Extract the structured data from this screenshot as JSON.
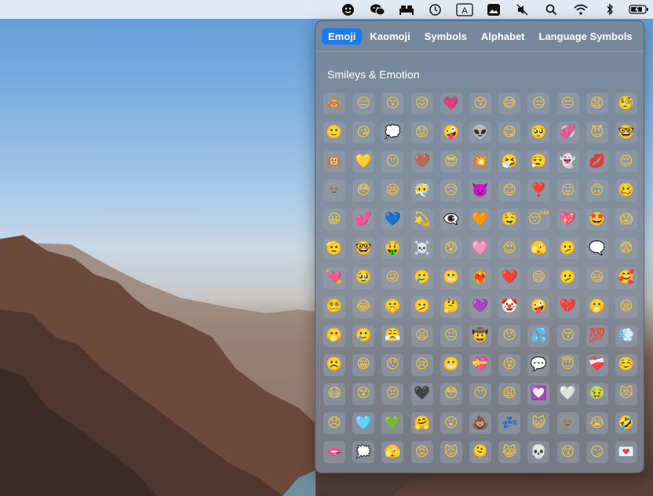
{
  "menubar": {
    "icons": [
      "smiley-icon",
      "wechat-icon",
      "bed-icon",
      "history-icon",
      "input-source-icon",
      "photo-icon",
      "mute-icon",
      "search-icon",
      "wifi-icon",
      "bluetooth-icon",
      "battery-icon"
    ],
    "input_source_label": "A"
  },
  "panel": {
    "tabs": [
      {
        "label": "Emoji",
        "active": true
      },
      {
        "label": "Kaomoji",
        "active": false
      },
      {
        "label": "Symbols",
        "active": false
      },
      {
        "label": "Alphabet",
        "active": false
      },
      {
        "label": "Language Symbols",
        "active": false
      }
    ],
    "section_title": "Smileys & Emotion",
    "emojis": [
      "🙈",
      "😑",
      "😗",
      "😖",
      "💗",
      "😙",
      "😅",
      "😒",
      "😔",
      "😧",
      "🧐",
      "🙂",
      "😘",
      "💭",
      "😟",
      "🤪",
      "👽",
      "😋",
      "🥺",
      "💞",
      "😈",
      "🤓",
      "🙉",
      "💛",
      "😶",
      "🤎",
      "😎",
      "💥",
      "🤧",
      "😮‍💨",
      "👻",
      "💋",
      "😌",
      "🫥",
      "😳",
      "😆",
      "😶‍🌫️",
      "😥",
      "👿",
      "😊",
      "❣️",
      "😛",
      "🙃",
      "🥴",
      "😀",
      "💕",
      "💙",
      "💫",
      "👁️‍🗨️",
      "🧡",
      "🤤",
      "😴",
      "💖",
      "🤩",
      "😱",
      "🫡",
      "🤓",
      "🤑",
      "☠️",
      "😰",
      "🩷",
      "😍",
      "🫣",
      "🫤",
      "🗨️",
      "😨",
      "💘",
      "🥹",
      "😜",
      "🥲",
      "😬",
      "❤️‍🔥",
      "❤️",
      "😄",
      "🫤",
      "😃",
      "🥰",
      "😵‍💫",
      "😂",
      "🤫",
      "🫤",
      "🤔",
      "💜",
      "🤡",
      "🤪",
      "💔",
      "🫢",
      "😪",
      "🫢",
      "🥲",
      "😤",
      "😦",
      "😐",
      "🤠",
      "😯",
      "💦",
      "😚",
      "💯",
      "💨",
      "☹️",
      "😁",
      "😯",
      "😢",
      "😬",
      "💝",
      "😵",
      "💬",
      "😇",
      "❤️‍🩹",
      "☺️",
      "😷",
      "😵",
      "😣",
      "🖤",
      "😳",
      "😶",
      "😩",
      "💟",
      "🤍",
      "🤢",
      "😻",
      "😞",
      "🩵",
      "💚",
      "🤗",
      "😮",
      "💩",
      "💤",
      "😺",
      "🫥",
      "😭",
      "🤣",
      "🫦",
      "🗯️",
      "🫣",
      "😡",
      "😾",
      "🫠",
      "😹",
      "💀",
      "😙",
      "😏",
      "💌"
    ]
  },
  "colors": {
    "accent": "#1a7cf0",
    "panel_bg": "#7a8492",
    "menubar_bg": "#ebf0f6"
  }
}
